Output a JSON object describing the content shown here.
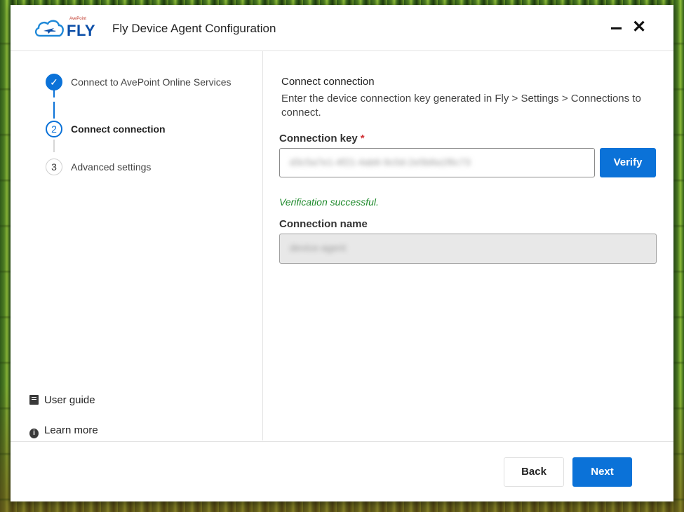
{
  "window": {
    "title": "Fly Device Agent Configuration",
    "logo_text": "FLY",
    "logo_brand": "AvePoint",
    "minimize_icon": "minimize-icon",
    "close_icon": "close-icon"
  },
  "steps": [
    {
      "number": "✓",
      "label": "Connect to AvePoint Online Services",
      "state": "done"
    },
    {
      "number": "2",
      "label": "Connect connection",
      "state": "active"
    },
    {
      "number": "3",
      "label": "Advanced settings",
      "state": "todo"
    }
  ],
  "sidebar_links": [
    {
      "label": "User guide",
      "icon": "book-icon"
    },
    {
      "label": "Learn more",
      "icon": "info-icon"
    }
  ],
  "main": {
    "title": "Connect connection",
    "description": "Enter the device connection key generated in Fly > Settings > Connections to connect.",
    "key_label": "Connection key",
    "required_mark": "*",
    "key_value": "d3c5a7e1-4f21-4ab6-9c0d-2e5b8a1f6c73",
    "verify_label": "Verify",
    "success_message": "Verification successful.",
    "name_label": "Connection name",
    "name_value": "device-agent"
  },
  "footer": {
    "back_label": "Back",
    "next_label": "Next"
  },
  "colors": {
    "accent": "#0b72d8",
    "success": "#1f8a2c",
    "required": "#d13438"
  }
}
